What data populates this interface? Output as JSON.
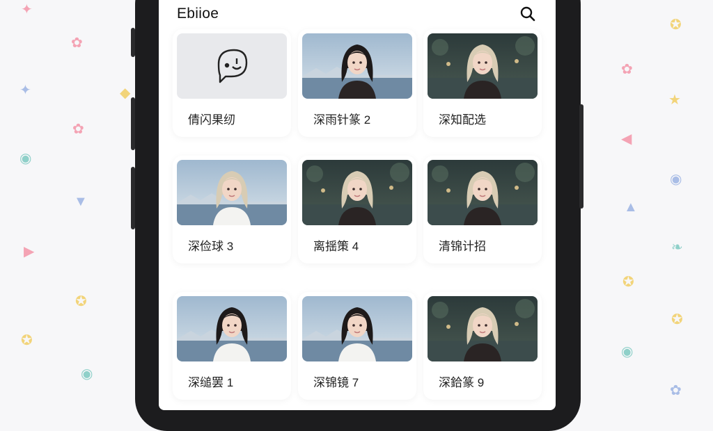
{
  "app": {
    "title": "Ebiioe"
  },
  "toolbar": {
    "search_icon": "search-icon"
  },
  "items": [
    {
      "label": "倩闪果纫",
      "thumb": "chat-placeholder"
    },
    {
      "label": "深雨针篆 2",
      "thumb": "dark-hair-girl-lake"
    },
    {
      "label": "深知配选",
      "thumb": "blonde-girl-night"
    },
    {
      "label": "深俭球 3",
      "thumb": "blonde-girl-mountains"
    },
    {
      "label": "离揺策 4",
      "thumb": "blonde-girl-night"
    },
    {
      "label": "清锦计招",
      "thumb": "blonde-girl-night"
    },
    {
      "label": "深缒罢 1",
      "thumb": "dark-hair-girl-mountains"
    },
    {
      "label": "深锦镜 7",
      "thumb": "dark-hair-girl-mountains"
    },
    {
      "label": "深鉿篆 9",
      "thumb": "blonde-girl-night"
    }
  ],
  "colors": {
    "accent_pink": "#f4a3b4",
    "accent_yellow": "#f2d47a",
    "accent_teal": "#8fd0c9",
    "accent_blue": "#a9bde6",
    "accent_purple": "#c9b8e8"
  }
}
